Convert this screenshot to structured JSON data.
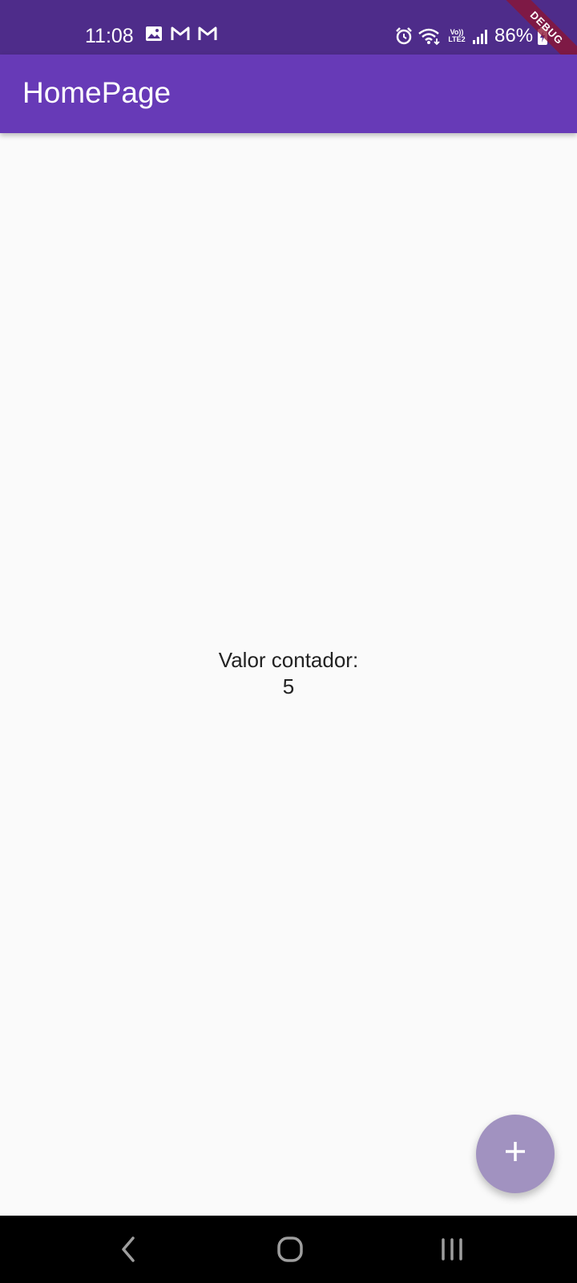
{
  "status_bar": {
    "time": "11:08",
    "left_icons": [
      "image-icon",
      "gmail-icon",
      "gmail-icon"
    ],
    "right_icons": [
      "alarm-icon",
      "wifi-icon",
      "volte-lte2-icon",
      "signal-icon",
      "battery-charging-icon"
    ],
    "lte_top": "Vo))",
    "lte_bottom": "LTE2",
    "battery": "86%"
  },
  "debug_banner": "DEBUG",
  "app_bar": {
    "title": "HomePage"
  },
  "body": {
    "counter_label": "Valor contador:",
    "counter_value": "5"
  },
  "fab": {
    "icon": "add-icon",
    "label": "+"
  },
  "nav_bar": {
    "buttons": [
      "back-icon",
      "home-icon",
      "recent-apps-icon"
    ]
  },
  "colors": {
    "status_bar": "#4e2c8a",
    "app_bar": "#673ab7",
    "background": "#fafafa",
    "fab": "#a192c0",
    "nav_bar": "#000000"
  }
}
